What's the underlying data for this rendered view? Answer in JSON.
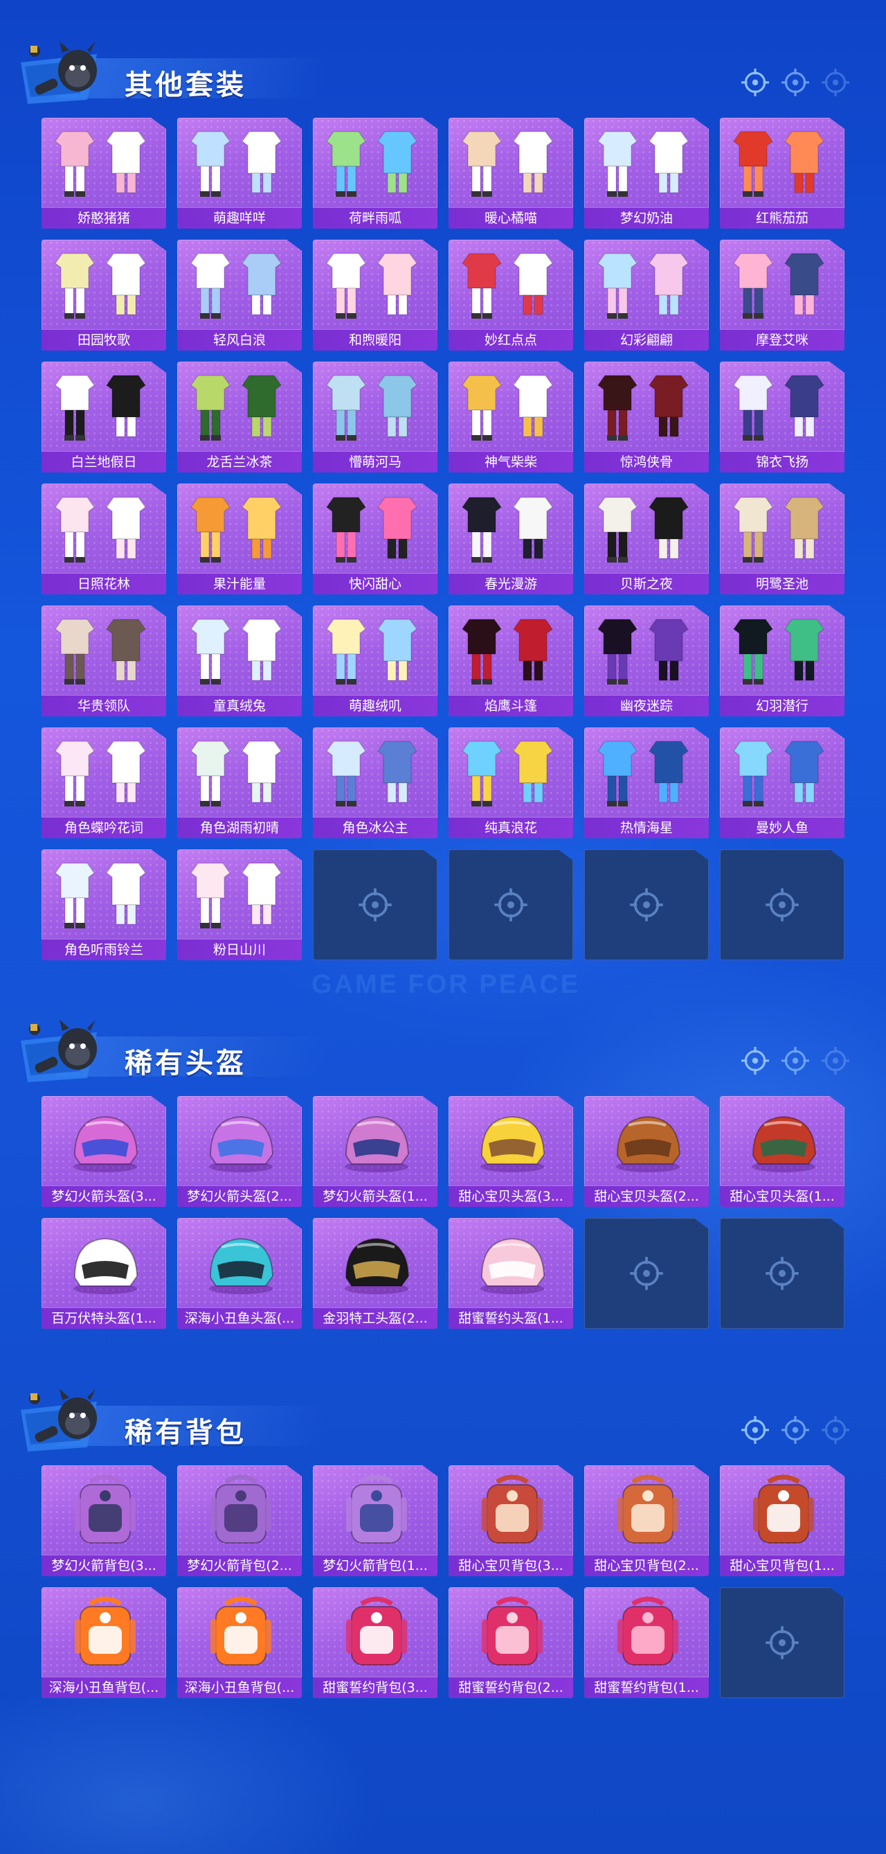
{
  "sections": [
    {
      "title": "其他套装",
      "item_type": "outfit",
      "items": [
        {
          "label": "娇憨猪猪",
          "palette": [
            "#f7b6d2",
            "#ffffff"
          ]
        },
        {
          "label": "萌趣咩咩",
          "palette": [
            "#bfe1ff",
            "#ffffff"
          ]
        },
        {
          "label": "荷畔雨呱",
          "palette": [
            "#9be28a",
            "#66c7ff"
          ]
        },
        {
          "label": "暖心橘喵",
          "palette": [
            "#f3d7b8",
            "#ffffff"
          ]
        },
        {
          "label": "梦幻奶油",
          "palette": [
            "#d8ecff",
            "#ffffff"
          ]
        },
        {
          "label": "红熊茄茄",
          "palette": [
            "#e23a2a",
            "#ff8a55"
          ]
        },
        {
          "label": "田园牧歌",
          "palette": [
            "#f3ecb0",
            "#ffffff"
          ]
        },
        {
          "label": "轻风白浪",
          "palette": [
            "#ffffff",
            "#a9cdf7"
          ]
        },
        {
          "label": "和煦暖阳",
          "palette": [
            "#ffffff",
            "#ffd5e2"
          ]
        },
        {
          "label": "妙红点点",
          "palette": [
            "#e03a48",
            "#ffffff"
          ]
        },
        {
          "label": "幻彩翩翩",
          "palette": [
            "#b9e3ff",
            "#f7c7ec"
          ]
        },
        {
          "label": "摩登艾咪",
          "palette": [
            "#ffb4d4",
            "#3a4b8a"
          ]
        },
        {
          "label": "白兰地假日",
          "palette": [
            "#ffffff",
            "#1c1c1c"
          ]
        },
        {
          "label": "龙舌兰冰茶",
          "palette": [
            "#b8d86a",
            "#2f6b2c"
          ]
        },
        {
          "label": "懵萌河马",
          "palette": [
            "#bfe0f2",
            "#8cc6e8"
          ]
        },
        {
          "label": "神气柴柴",
          "palette": [
            "#f4c04a",
            "#ffffff"
          ]
        },
        {
          "label": "惊鸿侠骨",
          "palette": [
            "#3a1518",
            "#7a1c24"
          ]
        },
        {
          "label": "锦衣飞扬",
          "palette": [
            "#f0f0ff",
            "#3a3d8a"
          ]
        },
        {
          "label": "日照花林",
          "palette": [
            "#fde5ef",
            "#ffffff"
          ]
        },
        {
          "label": "果汁能量",
          "palette": [
            "#f59a35",
            "#ffd066"
          ]
        },
        {
          "label": "快闪甜心",
          "palette": [
            "#222222",
            "#ff6fb0"
          ]
        },
        {
          "label": "春光漫游",
          "palette": [
            "#1e1e2c",
            "#f7f7f7"
          ]
        },
        {
          "label": "贝斯之夜",
          "palette": [
            "#f4f0ea",
            "#1b1b1b"
          ]
        },
        {
          "label": "明鹭圣池",
          "palette": [
            "#f1e6d2",
            "#d6b47c"
          ]
        },
        {
          "label": "华贵领队",
          "palette": [
            "#e9d7cc",
            "#6c5a52"
          ]
        },
        {
          "label": "童真绒兔",
          "palette": [
            "#dff1ff",
            "#ffffff"
          ]
        },
        {
          "label": "萌趣绒叽",
          "palette": [
            "#fff2b8",
            "#9fd6ff"
          ]
        },
        {
          "label": "焰鹰斗篷",
          "palette": [
            "#2a0f18",
            "#c01d2e"
          ]
        },
        {
          "label": "幽夜迷踪",
          "palette": [
            "#1a1024",
            "#6a3ab4"
          ]
        },
        {
          "label": "幻羽潜行",
          "palette": [
            "#101a20",
            "#3fbf86"
          ]
        },
        {
          "label": "角色蝶吟花词",
          "palette": [
            "#fbe7f5",
            "#ffffff"
          ]
        },
        {
          "label": "角色湖雨初晴",
          "palette": [
            "#e8f5ee",
            "#ffffff"
          ]
        },
        {
          "label": "角色冰公主",
          "palette": [
            "#d7ebff",
            "#5b7fd4"
          ]
        },
        {
          "label": "纯真浪花",
          "palette": [
            "#6fd1ff",
            "#f7d443"
          ]
        },
        {
          "label": "热情海星",
          "palette": [
            "#4fb0ff",
            "#2252a8"
          ]
        },
        {
          "label": "曼妙人鱼",
          "palette": [
            "#86d8ff",
            "#3a6fd8"
          ]
        },
        {
          "label": "角色听雨铃兰",
          "palette": [
            "#eaf4ff",
            "#ffffff"
          ]
        },
        {
          "label": "粉日山川",
          "palette": [
            "#fde7f0",
            "#ffffff"
          ]
        }
      ],
      "empty_slots": 4
    },
    {
      "title": "稀有头盔",
      "item_type": "helmet",
      "items": [
        {
          "label": "梦幻火箭头盔(3...",
          "palette": [
            "#d86ad8",
            "#3a4fd8"
          ]
        },
        {
          "label": "梦幻火箭头盔(2...",
          "palette": [
            "#c773e6",
            "#3e74e4"
          ]
        },
        {
          "label": "梦幻火箭头盔(1...",
          "palette": [
            "#d07ad0",
            "#2a3a8a"
          ]
        },
        {
          "label": "甜心宝贝头盔(3...",
          "palette": [
            "#f7d23a",
            "#8a5632"
          ]
        },
        {
          "label": "甜心宝贝头盔(2...",
          "palette": [
            "#b8652c",
            "#6a3a1a"
          ]
        },
        {
          "label": "甜心宝贝头盔(1...",
          "palette": [
            "#c43a28",
            "#2b6a46"
          ]
        },
        {
          "label": "百万伏特头盔(1...",
          "palette": [
            "#ffffff",
            "#1a1a1a"
          ]
        },
        {
          "label": "深海小丑鱼头盔(...",
          "palette": [
            "#39c4d8",
            "#1a2a3a"
          ]
        },
        {
          "label": "金羽特工头盔(2...",
          "palette": [
            "#1a1a1a",
            "#c9a34a"
          ]
        },
        {
          "label": "甜蜜誓约头盔(1...",
          "palette": [
            "#f7c9da",
            "#ffffff"
          ]
        }
      ],
      "empty_slots": 2
    },
    {
      "title": "稀有背包",
      "item_type": "backpack",
      "items": [
        {
          "label": "梦幻火箭背包(3...",
          "palette": [
            "#b06ad8",
            "#3a3a6a"
          ]
        },
        {
          "label": "梦幻火箭背包(2...",
          "palette": [
            "#a06ad0",
            "#4a3a7a"
          ]
        },
        {
          "label": "梦幻火箭背包(1...",
          "palette": [
            "#b47ee0",
            "#3a4a9a"
          ]
        },
        {
          "label": "甜心宝贝背包(3...",
          "palette": [
            "#c84a3a",
            "#fbe0c8"
          ]
        },
        {
          "label": "甜心宝贝背包(2...",
          "palette": [
            "#d5693a",
            "#fbe6d2"
          ]
        },
        {
          "label": "甜心宝贝背包(1...",
          "palette": [
            "#c44a2a",
            "#ffffff"
          ]
        },
        {
          "label": "深海小丑鱼背包(...",
          "palette": [
            "#ff7a22",
            "#ffffff"
          ]
        },
        {
          "label": "深海小丑鱼背包(...",
          "palette": [
            "#ff7a22",
            "#ffffff"
          ]
        },
        {
          "label": "甜蜜誓约背包(3...",
          "palette": [
            "#e0306a",
            "#ffffff"
          ]
        },
        {
          "label": "甜蜜誓约背包(2...",
          "palette": [
            "#e0306a",
            "#ffd0e0"
          ]
        },
        {
          "label": "甜蜜誓约背包(1...",
          "palette": [
            "#e0306a",
            "#ffb8d2"
          ]
        }
      ],
      "empty_slots": 1
    }
  ],
  "watermark": "GAME FOR PEACE",
  "colors": {
    "card_top": "#c37cf1",
    "card_bottom": "#8e4fdc",
    "label_bar": "#7a2fd2",
    "empty_slot": "#1f3f7c",
    "page_bg": "#1456dc"
  }
}
